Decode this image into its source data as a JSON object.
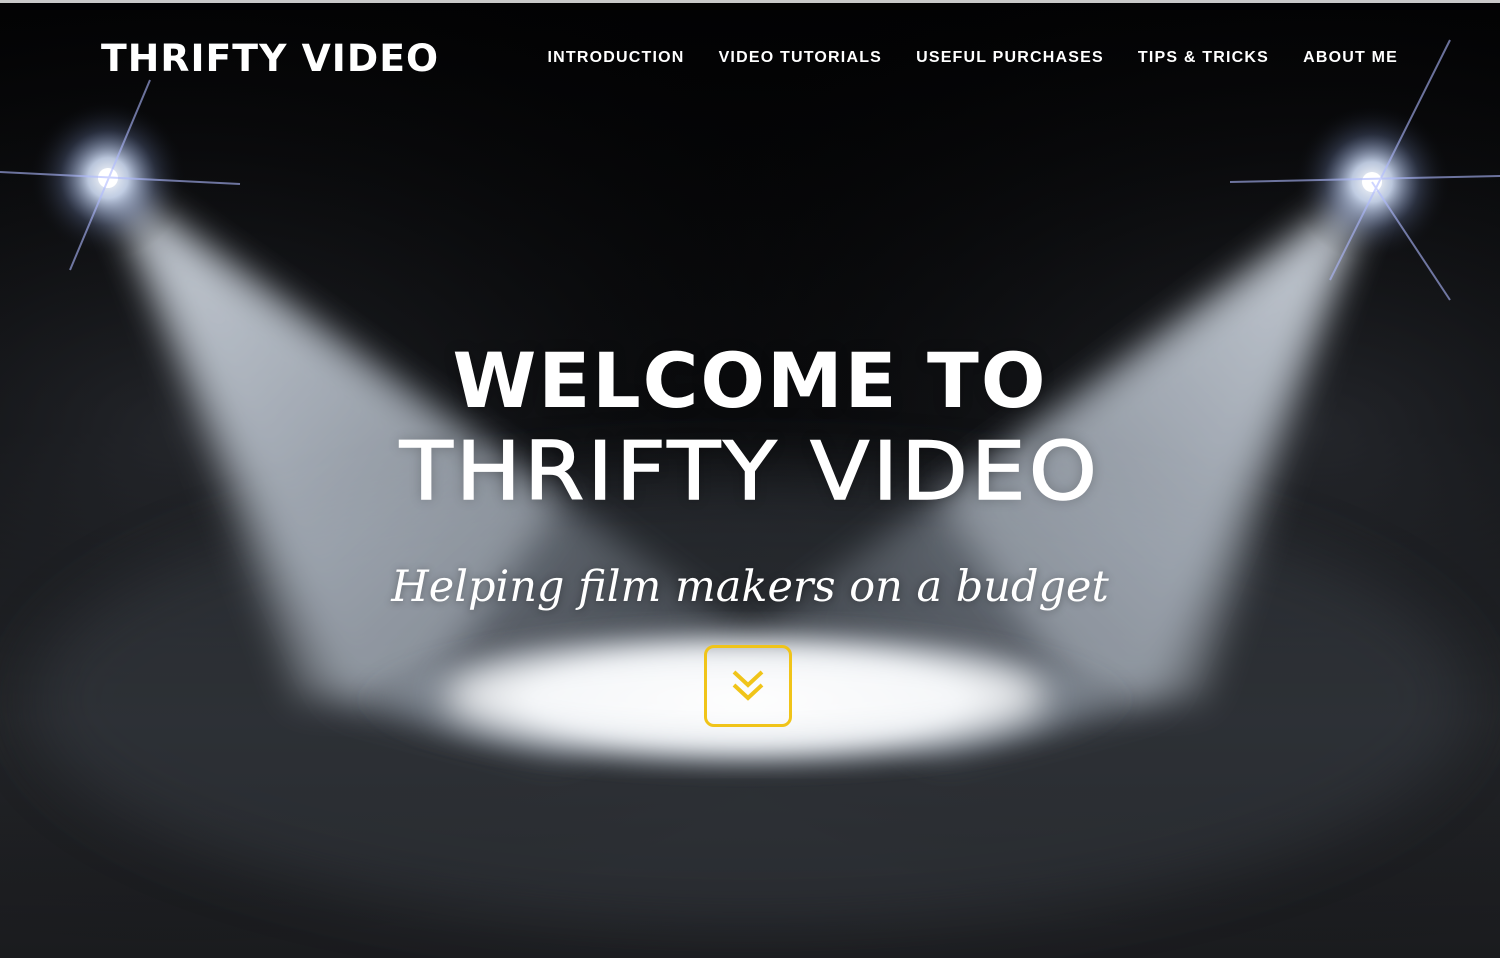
{
  "header": {
    "logo": "THRIFTY VIDEO",
    "nav": [
      {
        "label": "INTRODUCTION"
      },
      {
        "label": "VIDEO TUTORIALS"
      },
      {
        "label": "USEFUL PURCHASES"
      },
      {
        "label": "TIPS & TRICKS"
      },
      {
        "label": "ABOUT ME"
      }
    ]
  },
  "hero": {
    "title_line1": "WELCOME TO",
    "title_line2": "THRIFTY VIDEO",
    "subtitle": "Helping film makers on a budget",
    "scroll_icon": "double-chevron-down-icon",
    "background_image": "stage-spotlights"
  },
  "colors": {
    "background": "#030304",
    "text": "#ffffff",
    "accent": "#f0c419",
    "light_beam": "#dfe9f5"
  }
}
